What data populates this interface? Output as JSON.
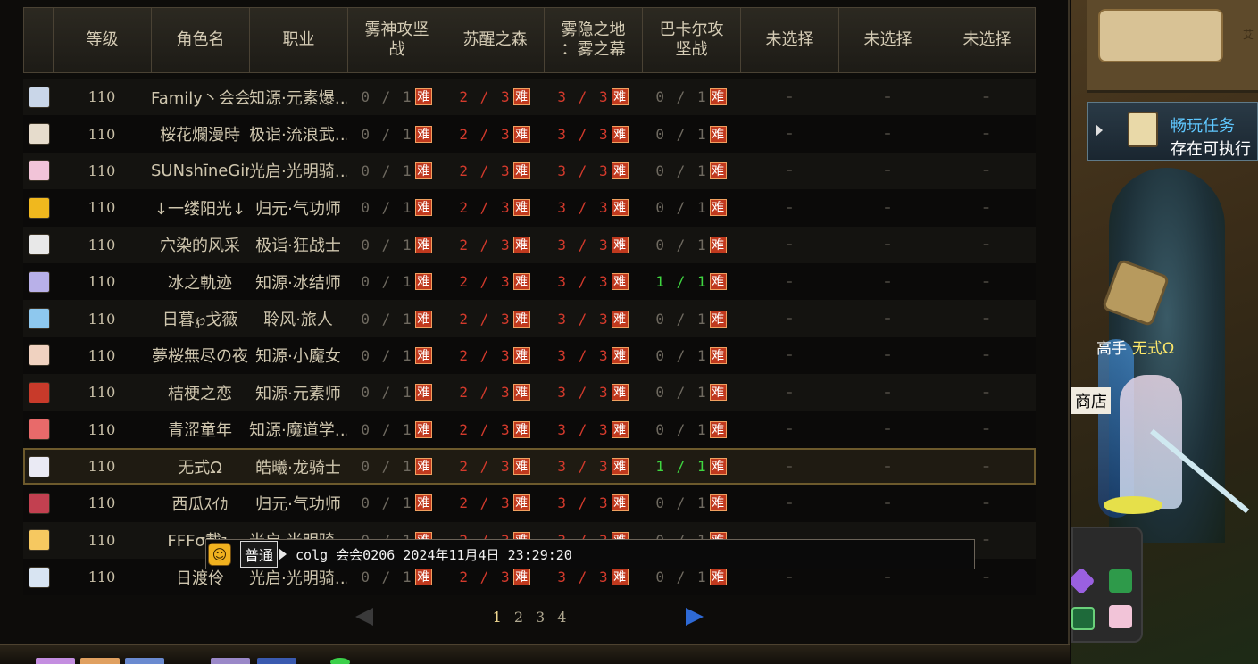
{
  "table": {
    "headers": [
      "",
      "等级",
      "角色名",
      "职业",
      "雾神攻坚\n战",
      "苏醒之森",
      "雾隐之地\n：雾之幕",
      "巴卡尔攻\n坚战",
      "未选择",
      "未选择",
      "未选择"
    ],
    "nan_label": "难",
    "dash": "–",
    "rows": [
      {
        "level": "110",
        "name": "Family丶会会",
        "job": "知源·元素爆…",
        "p1": "0 / 1",
        "p2": "2 / 3",
        "p3": "3 / 3",
        "p4": "0 / 1",
        "p4_status": "gray",
        "avatar_color": "#c9d6e8"
      },
      {
        "level": "110",
        "name": "桜花爛漫時",
        "job": "极诣·流浪武…",
        "p1": "0 / 1",
        "p2": "2 / 3",
        "p3": "3 / 3",
        "p4": "0 / 1",
        "p4_status": "gray",
        "avatar_color": "#e6dccc"
      },
      {
        "level": "110",
        "name": "SUNshīneGir",
        "job": "光启·光明骑…",
        "p1": "0 / 1",
        "p2": "2 / 3",
        "p3": "3 / 3",
        "p4": "0 / 1",
        "p4_status": "gray",
        "avatar_color": "#f2c4d8"
      },
      {
        "level": "110",
        "name": "↓一缕阳光↓",
        "job": "归元·气功师",
        "p1": "0 / 1",
        "p2": "2 / 3",
        "p3": "3 / 3",
        "p4": "0 / 1",
        "p4_status": "gray",
        "avatar_color": "#f0b81e"
      },
      {
        "level": "110",
        "name": "穴染的风采",
        "job": "极诣·狂战士",
        "p1": "0 / 1",
        "p2": "2 / 3",
        "p3": "3 / 3",
        "p4": "0 / 1",
        "p4_status": "gray",
        "avatar_color": "#e8e8e8"
      },
      {
        "level": "110",
        "name": "冰之軌迹",
        "job": "知源·冰结师",
        "p1": "0 / 1",
        "p2": "2 / 3",
        "p3": "3 / 3",
        "p4": "1 / 1",
        "p4_status": "green",
        "avatar_color": "#b8b0e8"
      },
      {
        "level": "110",
        "name": "日暮℘戈薇",
        "job": "聆风·旅人",
        "p1": "0 / 1",
        "p2": "2 / 3",
        "p3": "3 / 3",
        "p4": "0 / 1",
        "p4_status": "gray",
        "avatar_color": "#8ec8ee"
      },
      {
        "level": "110",
        "name": "夢桜無尽の夜",
        "job": "知源·小魔女",
        "p1": "0 / 1",
        "p2": "2 / 3",
        "p3": "3 / 3",
        "p4": "0 / 1",
        "p4_status": "gray",
        "avatar_color": "#f0d2c0"
      },
      {
        "level": "110",
        "name": "桔梗之恋",
        "job": "知源·元素师",
        "p1": "0 / 1",
        "p2": "2 / 3",
        "p3": "3 / 3",
        "p4": "0 / 1",
        "p4_status": "gray",
        "avatar_color": "#c83a2a"
      },
      {
        "level": "110",
        "name": "青涩童年",
        "job": "知源·魔道学…",
        "p1": "0 / 1",
        "p2": "2 / 3",
        "p3": "3 / 3",
        "p4": "0 / 1",
        "p4_status": "gray",
        "avatar_color": "#e86a6a"
      },
      {
        "level": "110",
        "name": "无式Ω",
        "job": "皓曦·龙骑士",
        "p1": "0 / 1",
        "p2": "2 / 3",
        "p3": "3 / 3",
        "p4": "1 / 1",
        "p4_status": "green",
        "avatar_color": "#eaeaf4",
        "selected": true
      },
      {
        "level": "110",
        "name": "西瓜ｽｲｶ",
        "job": "归元·气功师",
        "p1": "0 / 1",
        "p2": "2 / 3",
        "p3": "3 / 3",
        "p4": "0 / 1",
        "p4_status": "gray",
        "avatar_color": "#c24050"
      },
      {
        "level": "110",
        "name": "FFFσ載ъ",
        "job": "光启·光明骑…",
        "p1": "0 / 1",
        "p2": "2 / 3",
        "p3": "3 / 3",
        "p4": "0 / 1",
        "p4_status": "gray",
        "avatar_color": "#f6c860"
      },
      {
        "level": "110",
        "name": "日渡伶",
        "job": "光启·光明骑…",
        "p1": "0 / 1",
        "p2": "2 / 3",
        "p3": "3 / 3",
        "p4": "0 / 1",
        "p4_status": "gray",
        "avatar_color": "#d8e4f2"
      }
    ]
  },
  "pager": {
    "pages": [
      "1",
      "2",
      "3",
      "4"
    ],
    "current": "1"
  },
  "chat": {
    "channel": "普通",
    "text": "colg 会会0206 2024年11月4日 23:29:20"
  },
  "scene": {
    "sign_char": "艾",
    "quest_title": "畅玩任务",
    "quest_sub": "存在可执行",
    "player_rank": "高手",
    "player_name": "无式Ω",
    "shop_label": "商店"
  },
  "colors": {
    "red": "#d43a2c",
    "green": "#3fd640",
    "gray": "#6f6a60",
    "nan_bg": "#c0391e"
  }
}
